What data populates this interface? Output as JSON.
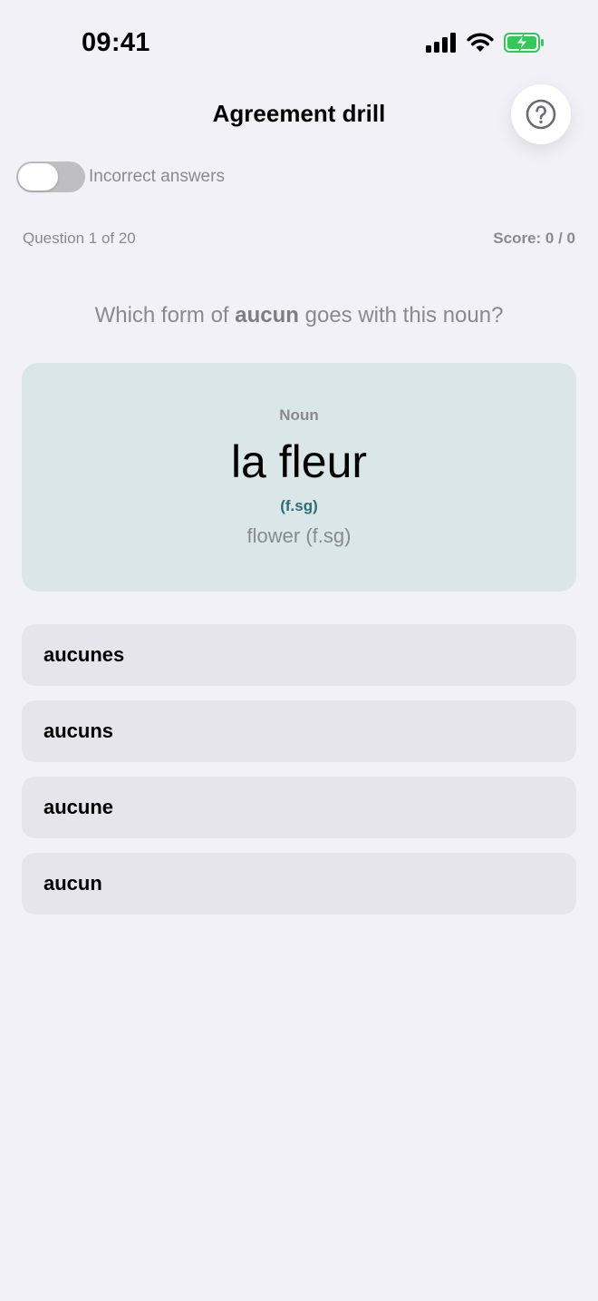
{
  "status_bar": {
    "time": "09:41"
  },
  "header": {
    "title": "Agreement drill",
    "help_icon": "question-circle-icon"
  },
  "toggle": {
    "label": "Incorrect answers",
    "on": false
  },
  "progress": {
    "question": "Question 1 of 20",
    "score": "Score: 0 / 0"
  },
  "prompt": {
    "before": "Which form of ",
    "keyword": "aucun",
    "after": " goes with this noun?"
  },
  "noun_card": {
    "kicker": "Noun",
    "word": "la fleur",
    "tag": "(f.sg)",
    "gloss": "flower (f.sg)"
  },
  "options": [
    {
      "label": "aucunes"
    },
    {
      "label": "aucuns"
    },
    {
      "label": "aucune"
    },
    {
      "label": "aucun"
    }
  ],
  "colors": {
    "background": "#f2f1f7",
    "card": "#dbe6e8",
    "option": "#e6e5eb",
    "tag_teal": "#2d6e74",
    "battery_green": "#34c759"
  }
}
